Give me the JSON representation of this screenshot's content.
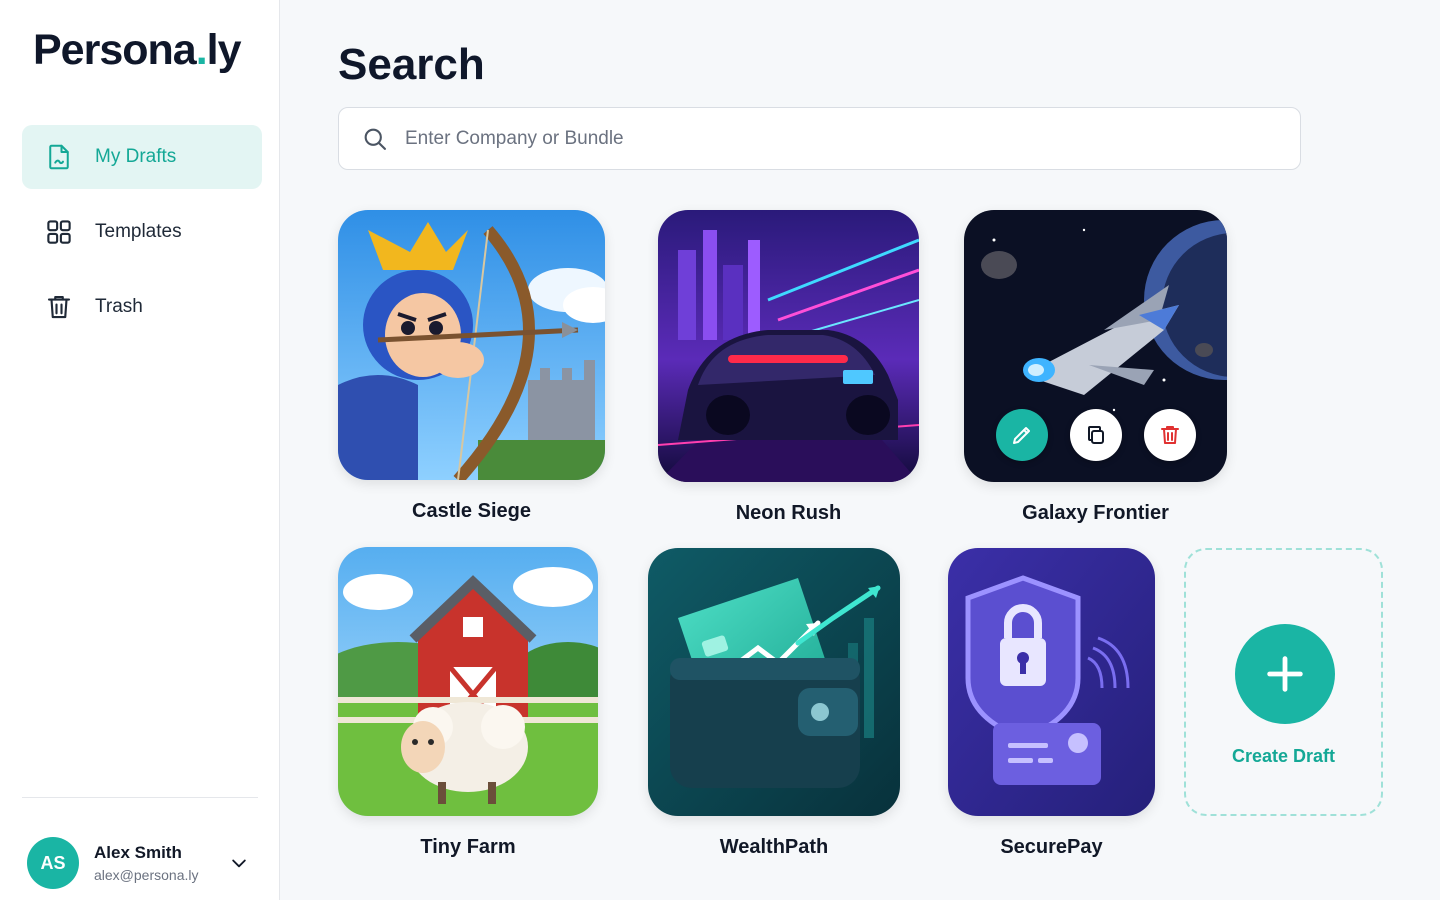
{
  "brand": {
    "name_main": "Persona",
    "name_dot": ".",
    "name_tail": "ly",
    "accent": "#1ab5a4"
  },
  "sidebar": {
    "items": [
      {
        "label": "My Drafts",
        "icon": "document-icon",
        "active": true
      },
      {
        "label": "Templates",
        "icon": "grid-icon",
        "active": false
      },
      {
        "label": "Trash",
        "icon": "trash-icon",
        "active": false
      }
    ]
  },
  "user": {
    "initials": "AS",
    "name": "Alex Smith",
    "email": "alex@persona.ly"
  },
  "main": {
    "title": "Search",
    "search": {
      "placeholder": "Enter Company or Bundle",
      "value": ""
    },
    "drafts": [
      {
        "name": "Castle Siege"
      },
      {
        "name": "Neon Rush"
      },
      {
        "name": "Galaxy Frontier",
        "hover_actions": [
          "edit-icon",
          "copy-icon",
          "trash-icon"
        ]
      },
      {
        "name": "Tiny Farm"
      },
      {
        "name": "WealthPath"
      },
      {
        "name": "SecurePay"
      }
    ],
    "create_label": "Create Draft"
  }
}
